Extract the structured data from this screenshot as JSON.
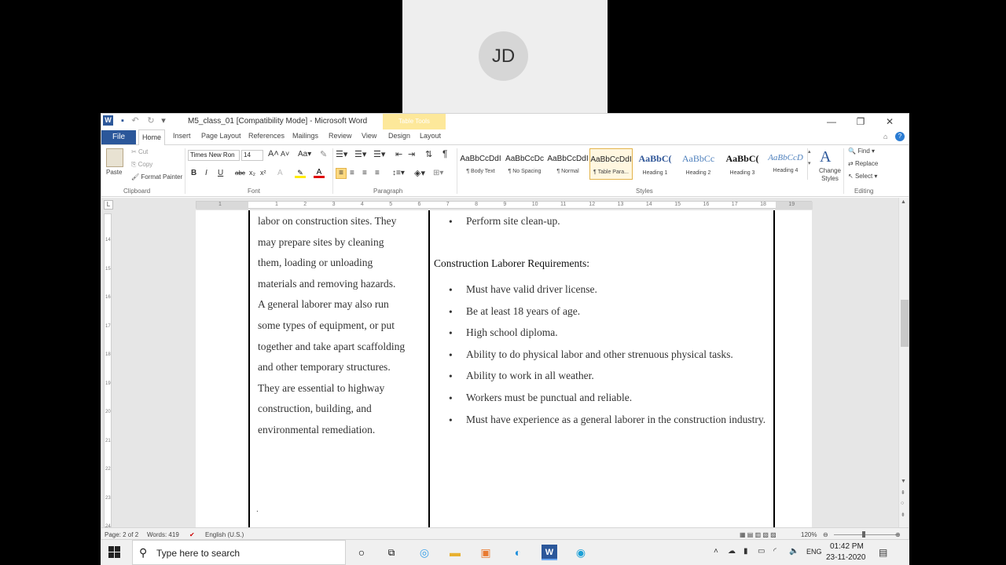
{
  "video": {
    "initials": "JD"
  },
  "window": {
    "title": "M5_class_01 [Compatibility Mode] - Microsoft Word",
    "table_tools": "Table Tools",
    "min": "—",
    "max": "❐",
    "close": "✕"
  },
  "tabs": {
    "file": "File",
    "items": [
      "Home",
      "Insert",
      "Page Layout",
      "References",
      "Mailings",
      "Review",
      "View",
      "Design",
      "Layout"
    ]
  },
  "ribbon": {
    "clipboard": {
      "paste": "Paste",
      "cut": "Cut",
      "copy": "Copy",
      "format_painter": "Format Painter",
      "label": "Clipboard"
    },
    "font": {
      "name": "Times New Ron",
      "size": "14",
      "label": "Font",
      "bold": "B",
      "italic": "I",
      "underline": "U",
      "strike": "abc",
      "sub": "x₂",
      "sup": "x²"
    },
    "paragraph": {
      "label": "Paragraph",
      "pilcrow": "¶"
    },
    "styles": {
      "label": "Styles",
      "items": [
        {
          "preview": "AaBbCcDdI",
          "name": "¶ Body Text"
        },
        {
          "preview": "AaBbCcDc",
          "name": "¶ No Spacing"
        },
        {
          "preview": "AaBbCcDdI",
          "name": "¶ Normal"
        },
        {
          "preview": "AaBbCcDdI",
          "name": "¶ Table Para..."
        },
        {
          "preview": "AaBbC(",
          "name": "Heading 1"
        },
        {
          "preview": "AaBbCc",
          "name": "Heading 2"
        },
        {
          "preview": "AaBbC(",
          "name": "Heading 3"
        },
        {
          "preview": "AaBbCcD",
          "name": "Heading 4"
        }
      ],
      "change_styles": "Change Styles"
    },
    "editing": {
      "find": "Find",
      "replace": "Replace",
      "select": "Select",
      "label": "Editing"
    }
  },
  "ruler": {
    "numbers": [
      "1",
      "1",
      "2",
      "3",
      "4",
      "5",
      "6",
      "7",
      "8",
      "9",
      "10",
      "11",
      "12",
      "13",
      "14",
      "15",
      "16",
      "17",
      "18",
      "19"
    ]
  },
  "vruler": {
    "numbers": [
      "14",
      "15",
      "16",
      "17",
      "18",
      "19",
      "20",
      "21",
      "22",
      "23",
      "24"
    ]
  },
  "doc": {
    "left_column": [
      "labor on construction sites. They",
      "may prepare sites by cleaning",
      "them, loading or unloading",
      "materials and removing hazards.",
      "A general laborer may also run",
      "some types of equipment, or put",
      "together and take apart scaffolding",
      "and other temporary structures.",
      "They are essential to highway",
      "construction, building, and",
      "environmental remediation."
    ],
    "top_bullet": "Perform site clean-up.",
    "requirements_heading": "Construction Laborer Requirements:",
    "requirements": [
      "Must have valid driver license.",
      "Be at least 18 years of age.",
      "High school diploma.",
      "Ability to do physical labor and other strenuous physical tasks.",
      "Ability to work in all weather.",
      "Workers must be punctual and reliable.",
      "Must have experience as a general laborer in the construction industry."
    ]
  },
  "status": {
    "page": "Page: 2 of 2",
    "words": "Words: 419",
    "language": "English (U.S.)",
    "zoom": "120%"
  },
  "taskbar": {
    "search_placeholder": "Type here to search",
    "lang": "ENG",
    "time": "01:42 PM",
    "date": "23-11-2020"
  }
}
